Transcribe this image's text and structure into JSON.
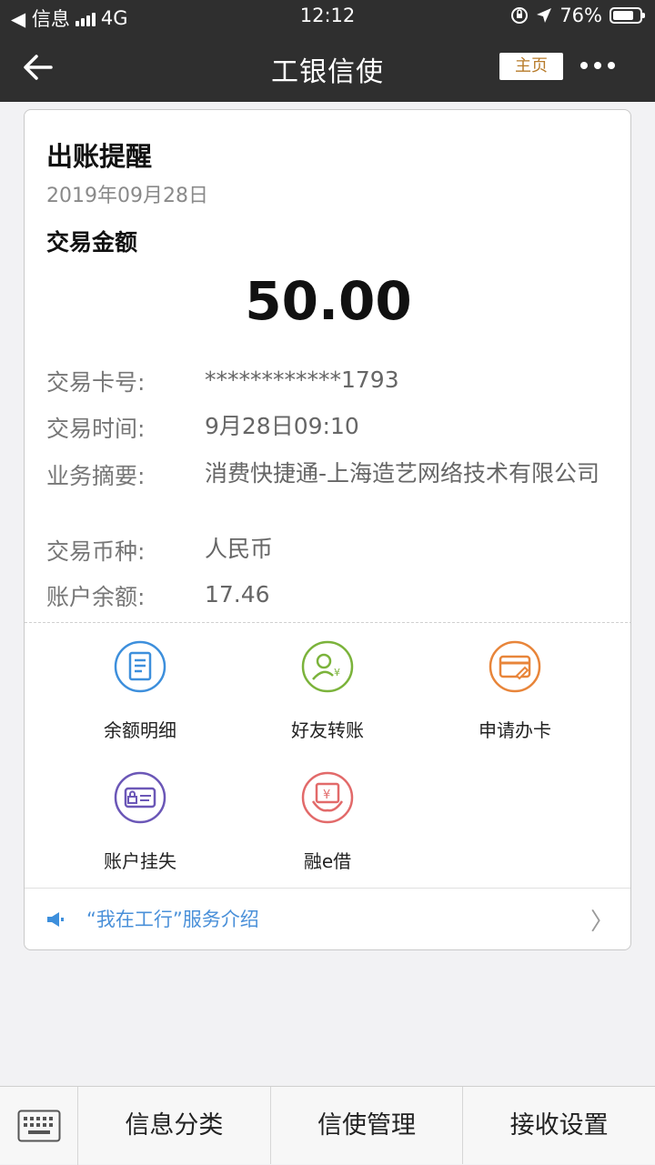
{
  "status_bar": {
    "back_app": "◀ 信息",
    "network": "4G",
    "time": "12:12",
    "battery": "76%",
    "battery_level": 0.76
  },
  "nav": {
    "title": "工银信使",
    "home_label": "主页"
  },
  "card": {
    "title": "出账提醒",
    "date": "2019年09月28日",
    "amount_label": "交易金额",
    "amount_value": "50.00",
    "rows": [
      {
        "key": "交易卡号:",
        "value": "************1793"
      },
      {
        "key": "交易时间:",
        "value": "9月28日09:10"
      },
      {
        "key": "业务摘要:",
        "value": "消费快捷通-上海造艺网络技术有限公司"
      },
      {
        "key": "交易币种:",
        "value": "人民币"
      },
      {
        "key": "账户余额:",
        "value": "17.46"
      }
    ],
    "services": [
      {
        "label": "余额明细",
        "icon": "document-icon",
        "color": "#3d8fdc"
      },
      {
        "label": "好友转账",
        "icon": "transfer-user-icon",
        "color": "#7bb33b"
      },
      {
        "label": "申请办卡",
        "icon": "credit-card-icon",
        "color": "#e8853a"
      },
      {
        "label": "账户挂失",
        "icon": "lock-card-icon",
        "color": "#6b57b7"
      },
      {
        "label": "融e借",
        "icon": "loan-icon",
        "color": "#e26a6a"
      }
    ],
    "intro": "“我在工行”服务介绍",
    "intro_chevron": "〉"
  },
  "tabbar": {
    "tabs": [
      "信息分类",
      "信使管理",
      "接收设置"
    ]
  },
  "colors": {
    "header_bg": "#2f2f2f",
    "accent_link": "#4a90d9",
    "home_btn_text": "#b77b2a"
  }
}
